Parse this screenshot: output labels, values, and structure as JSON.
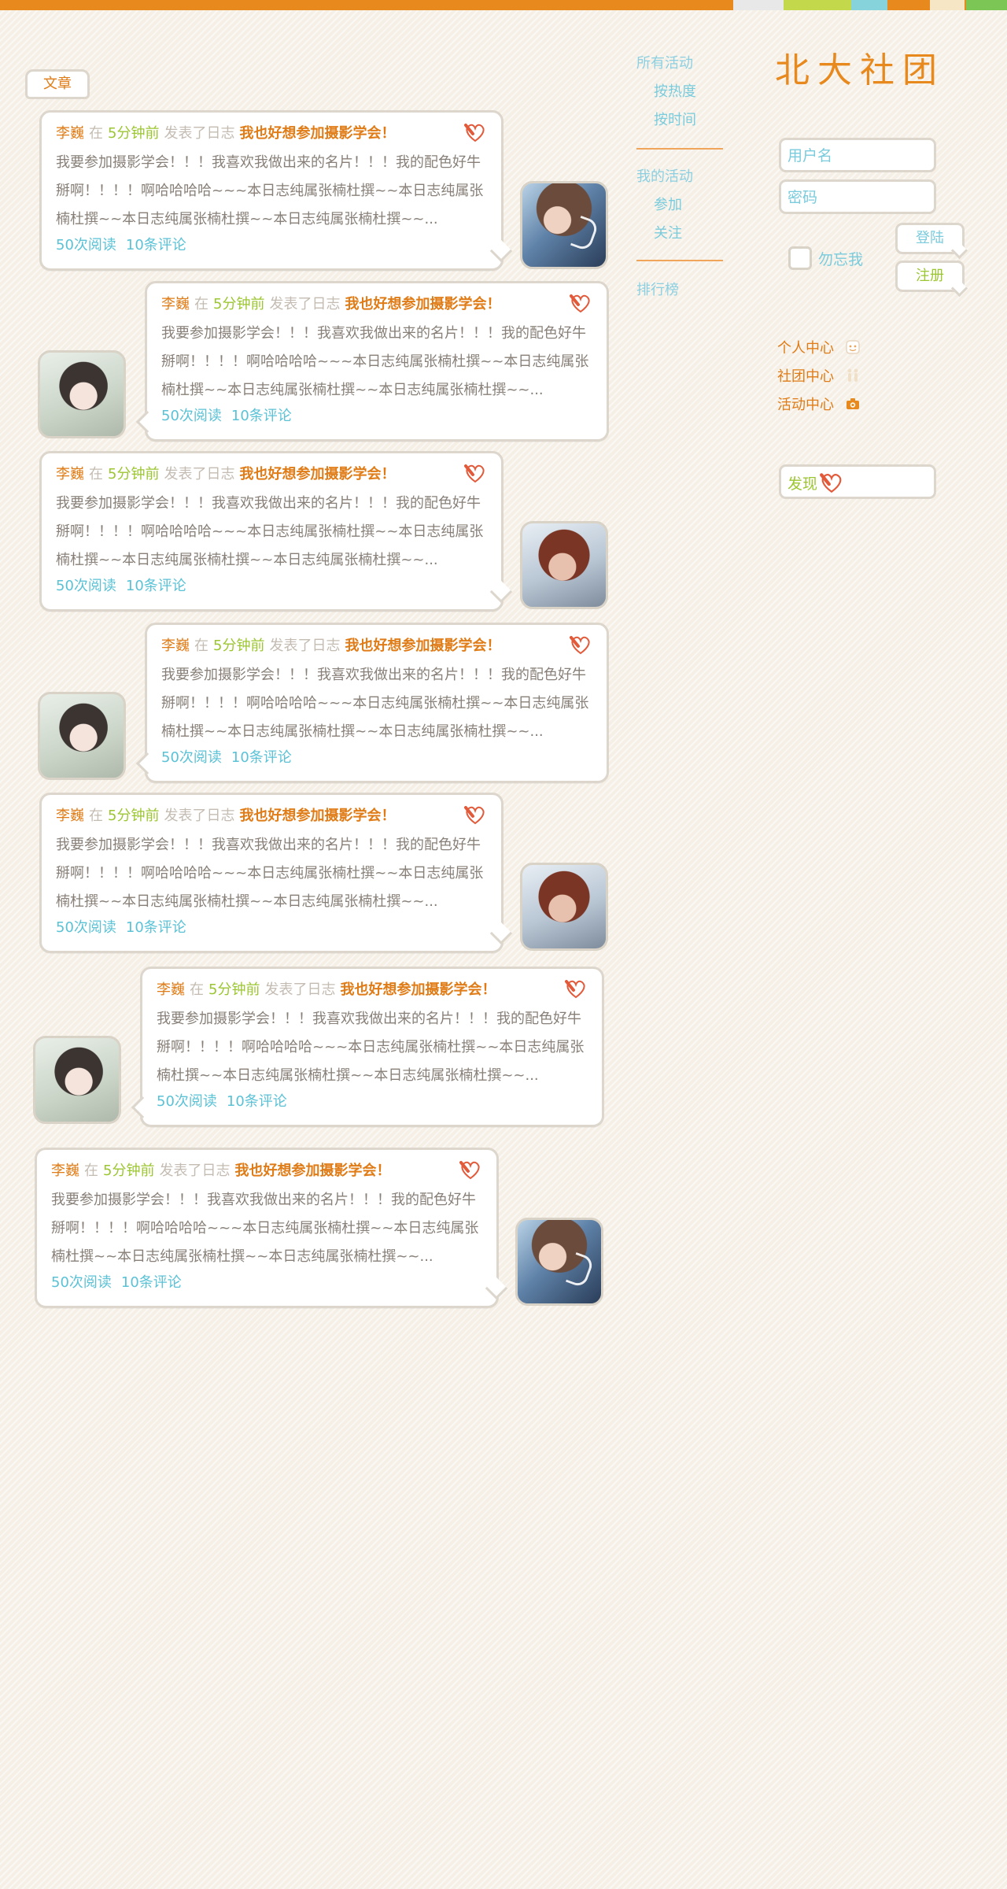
{
  "colors": {
    "accent_orange": "#e07c17",
    "accent_green": "#9cc631",
    "accent_cyan": "#7acbdc",
    "text_grey": "#888078",
    "background": "#f5efe6"
  },
  "site": {
    "logo_text": "北大社团",
    "section_tab": "文章"
  },
  "nav": {
    "all_activities": "所有活动",
    "by_heat": "按热度",
    "by_time": "按时间",
    "my_activities": "我的活动",
    "join": "参加",
    "follow": "关注",
    "ranking": "排行榜"
  },
  "login": {
    "username_placeholder": "用户名",
    "password_placeholder": "密码",
    "remember_me": "勿忘我",
    "login_button": "登陆",
    "register_button": "注册"
  },
  "centers": {
    "personal": "个人中心",
    "club": "社团中心",
    "activity": "活动中心"
  },
  "discover": {
    "label": "发现"
  },
  "posts": [
    {
      "author": "李巍",
      "preposition": "在",
      "time": "5分钟前",
      "action": "发表了日志",
      "title": "我也好想参加摄影学会！",
      "body": "我要参加摄影学会！！！我喜欢我做出来的名片！！！我的配色好牛掰啊！！！！啊哈哈哈哈~~~本日志纯属张楠杜撰~~本日志纯属张楠杜撰~~本日志纯属张楠杜撰~~本日志纯属张楠杜撰~~...",
      "reads": "50次阅读",
      "comments": "10条评论",
      "avatar_icon": "avatar-girl-blue"
    },
    {
      "author": "李巍",
      "preposition": "在",
      "time": "5分钟前",
      "action": "发表了日志",
      "title": "我也好想参加摄影学会！",
      "body": "我要参加摄影学会！！！我喜欢我做出来的名片！！！我的配色好牛掰啊！！！！啊哈哈哈哈~~~本日志纯属张楠杜撰~~本日志纯属张楠杜撰~~本日志纯属张楠杜撰~~本日志纯属张楠杜撰~~...",
      "reads": "50次阅读",
      "comments": "10条评论",
      "avatar_icon": "avatar-girl-light"
    },
    {
      "author": "李巍",
      "preposition": "在",
      "time": "5分钟前",
      "action": "发表了日志",
      "title": "我也好想参加摄影学会！",
      "body": "我要参加摄影学会！！！我喜欢我做出来的名片！！！我的配色好牛掰啊！！！！啊哈哈哈哈~~~本日志纯属张楠杜撰~~本日志纯属张楠杜撰~~本日志纯属张楠杜撰~~本日志纯属张楠杜撰~~...",
      "reads": "50次阅读",
      "comments": "10条评论",
      "avatar_icon": "avatar-girl-redhair"
    },
    {
      "author": "李巍",
      "preposition": "在",
      "time": "5分钟前",
      "action": "发表了日志",
      "title": "我也好想参加摄影学会！",
      "body": "我要参加摄影学会！！！我喜欢我做出来的名片！！！我的配色好牛掰啊！！！！啊哈哈哈哈~~~本日志纯属张楠杜撰~~本日志纯属张楠杜撰~~本日志纯属张楠杜撰~~本日志纯属张楠杜撰~~...",
      "reads": "50次阅读",
      "comments": "10条评论",
      "avatar_icon": "avatar-girl-light"
    },
    {
      "author": "李巍",
      "preposition": "在",
      "time": "5分钟前",
      "action": "发表了日志",
      "title": "我也好想参加摄影学会！",
      "body": "我要参加摄影学会！！！我喜欢我做出来的名片！！！我的配色好牛掰啊！！！！啊哈哈哈哈~~~本日志纯属张楠杜撰~~本日志纯属张楠杜撰~~本日志纯属张楠杜撰~~本日志纯属张楠杜撰~~...",
      "reads": "50次阅读",
      "comments": "10条评论",
      "avatar_icon": "avatar-girl-redhair"
    },
    {
      "author": "李巍",
      "preposition": "在",
      "time": "5分钟前",
      "action": "发表了日志",
      "title": "我也好想参加摄影学会！",
      "body": "我要参加摄影学会！！！我喜欢我做出来的名片！！！我的配色好牛掰啊！！！！啊哈哈哈哈~~~本日志纯属张楠杜撰~~本日志纯属张楠杜撰~~本日志纯属张楠杜撰~~本日志纯属张楠杜撰~~...",
      "reads": "50次阅读",
      "comments": "10条评论",
      "avatar_icon": "avatar-girl-light"
    },
    {
      "author": "李巍",
      "preposition": "在",
      "time": "5分钟前",
      "action": "发表了日志",
      "title": "我也好想参加摄影学会！",
      "body": "我要参加摄影学会！！！我喜欢我做出来的名片！！！我的配色好牛掰啊！！！！啊哈哈哈哈~~~本日志纯属张楠杜撰~~本日志纯属张楠杜撰~~本日志纯属张楠杜撰~~本日志纯属张楠杜撰~~...",
      "reads": "50次阅读",
      "comments": "10条评论",
      "avatar_icon": "avatar-girl-blue"
    }
  ]
}
